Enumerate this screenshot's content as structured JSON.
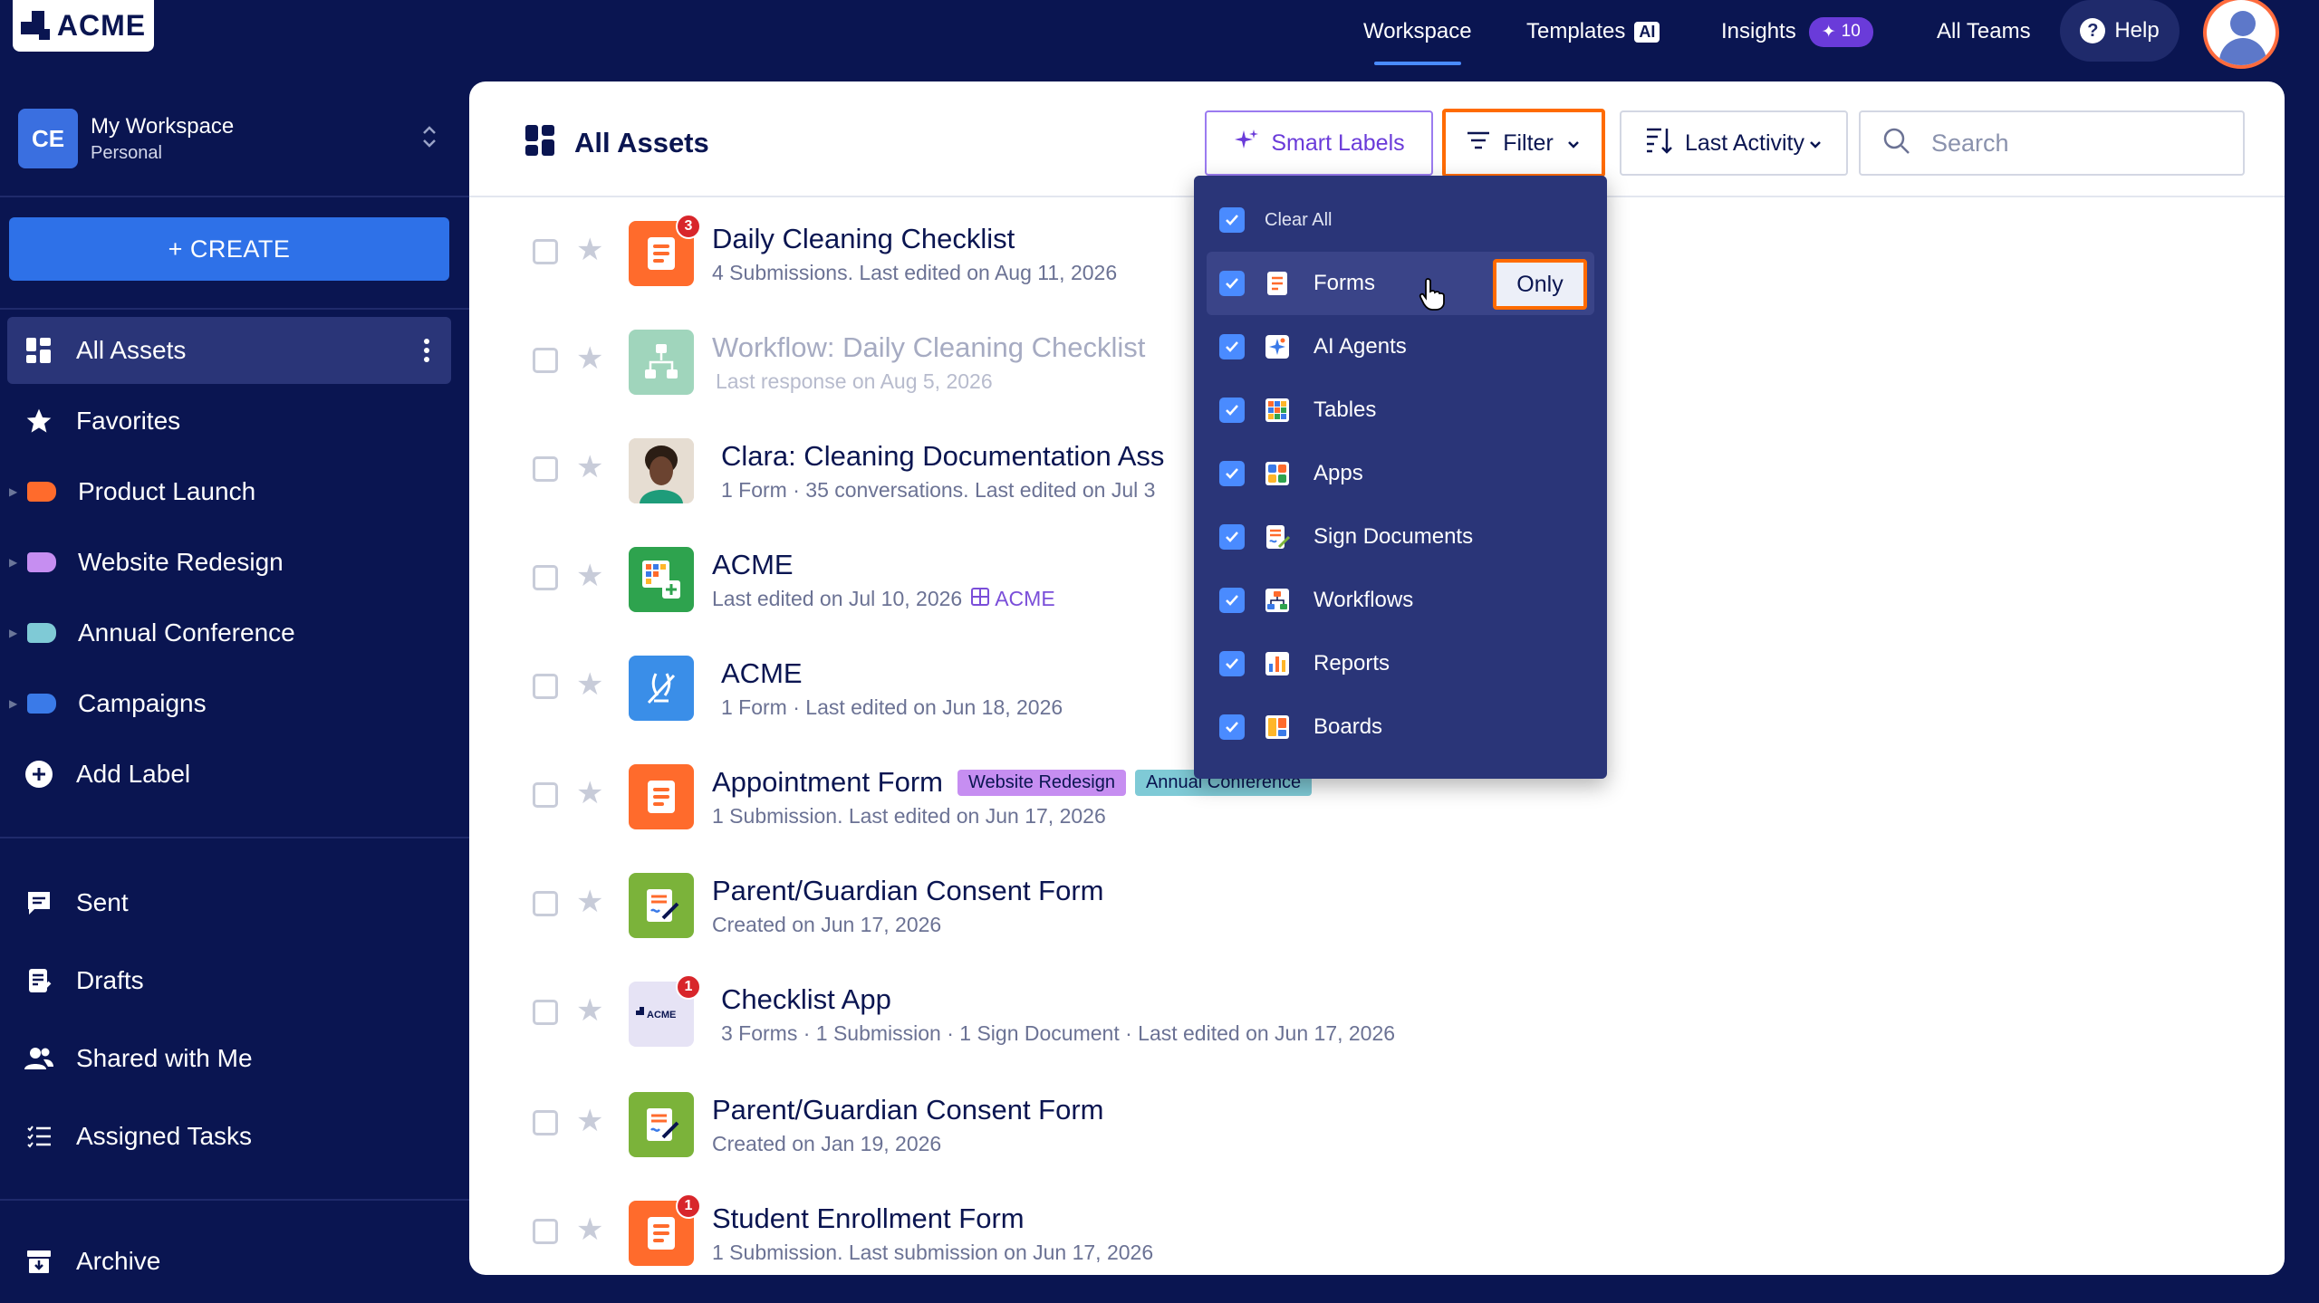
{
  "brand": {
    "name": "ACME"
  },
  "topnav": {
    "workspace": "Workspace",
    "templates": "Templates",
    "templates_badge": "AI",
    "insights": "Insights",
    "insights_badge": "10",
    "all_teams": "All Teams",
    "help": "Help"
  },
  "workspace": {
    "initials": "CE",
    "name": "My Workspace",
    "type": "Personal"
  },
  "sidebar": {
    "create_label": "+ CREATE",
    "items": [
      {
        "label": "All Assets",
        "icon": "grid-icon"
      },
      {
        "label": "Favorites",
        "icon": "star-icon"
      }
    ],
    "labels": [
      {
        "label": "Product Launch",
        "color": "#ff6b2c"
      },
      {
        "label": "Website Redesign",
        "color": "#c68ef1"
      },
      {
        "label": "Annual Conference",
        "color": "#7fcad6"
      },
      {
        "label": "Campaigns",
        "color": "#3a7ae8"
      }
    ],
    "add_label": "Add Label",
    "sections": [
      {
        "label": "Sent",
        "icon": "message-icon"
      },
      {
        "label": "Drafts",
        "icon": "draft-icon"
      },
      {
        "label": "Shared with Me",
        "icon": "people-icon"
      },
      {
        "label": "Assigned Tasks",
        "icon": "tasks-icon"
      }
    ],
    "archive": "Archive"
  },
  "main": {
    "title": "All Assets",
    "smart_labels": "Smart Labels",
    "filter": "Filter",
    "sort": "Last Activity",
    "search_placeholder": "Search"
  },
  "assets": [
    {
      "name": "Daily Cleaning Checklist",
      "meta": "4 Submissions. Last edited on Aug 11, 2026",
      "type": "form",
      "badge": "3"
    },
    {
      "name": "Workflow: Daily Cleaning Checklist",
      "meta": "Last response on Aug 5, 2026",
      "type": "workflow"
    },
    {
      "name": "Clara: Cleaning Documentation Ass",
      "meta": "1 Form · 35 conversations. Last edited on Jul 3",
      "type": "agent"
    },
    {
      "name": "ACME",
      "meta": "Last edited on Jul 10, 2026",
      "meta_link": "ACME",
      "type": "table"
    },
    {
      "name": "ACME",
      "meta": "1 Form · Last edited on Jun 18, 2026",
      "type": "app"
    },
    {
      "name": "Appointment Form",
      "meta": "1 Submission. Last edited on Jun 17, 2026",
      "type": "form",
      "tags": [
        "Website Redesign",
        "Annual Conference"
      ]
    },
    {
      "name": "Parent/Guardian Consent Form",
      "meta": "Created on Jun 17, 2026",
      "type": "sign"
    },
    {
      "name": "Checklist App",
      "meta": "3 Forms · 1 Submission · 1 Sign Document · Last edited on Jun 17, 2026",
      "type": "app-acme",
      "badge": "1"
    },
    {
      "name": "Parent/Guardian Consent Form",
      "meta": "Created on Jan 19, 2026",
      "type": "sign"
    },
    {
      "name": "Student Enrollment Form",
      "meta": "1 Submission. Last submission on Jun 17, 2026",
      "type": "form",
      "badge": "1"
    }
  ],
  "filter_menu": {
    "clear_all": "Clear All",
    "only": "Only",
    "options": [
      {
        "label": "Forms",
        "icon": "form-icon",
        "checked": true
      },
      {
        "label": "AI Agents",
        "icon": "ai-agent-icon",
        "checked": true
      },
      {
        "label": "Tables",
        "icon": "table-icon",
        "checked": true
      },
      {
        "label": "Apps",
        "icon": "apps-icon",
        "checked": true
      },
      {
        "label": "Sign Documents",
        "icon": "sign-icon",
        "checked": true
      },
      {
        "label": "Workflows",
        "icon": "workflow-icon",
        "checked": true
      },
      {
        "label": "Reports",
        "icon": "report-icon",
        "checked": true
      },
      {
        "label": "Boards",
        "icon": "board-icon",
        "checked": true
      }
    ]
  },
  "colors": {
    "navy": "#0a1551",
    "accent_blue": "#2e71e8",
    "highlight_orange": "#ff6b00",
    "purple": "#6a3bd9"
  }
}
